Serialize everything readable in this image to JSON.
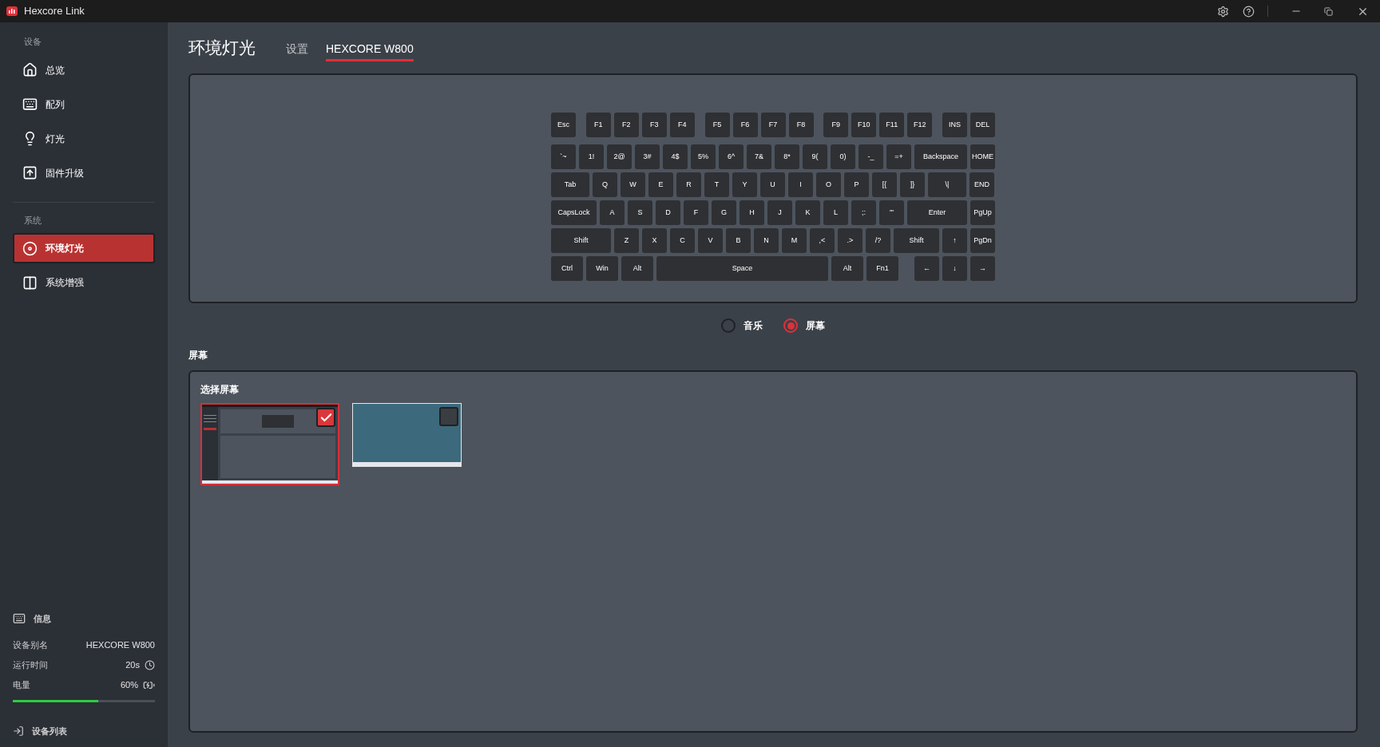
{
  "window": {
    "title": "Hexcore Link"
  },
  "sidebar": {
    "sections": [
      {
        "heading": "设备",
        "items": [
          {
            "label": "总览",
            "selected": false
          },
          {
            "label": "配列",
            "selected": false
          },
          {
            "label": "灯光",
            "selected": false
          },
          {
            "label": "固件升级",
            "selected": false
          }
        ]
      },
      {
        "heading": "系统",
        "items": [
          {
            "label": "环境灯光",
            "selected": true
          },
          {
            "label": "系统增强",
            "selected": false
          }
        ]
      }
    ],
    "info": {
      "heading": "信息",
      "rows": [
        {
          "label": "设备别名",
          "value": "HEXCORE W800",
          "kind": "text"
        },
        {
          "label": "运行时间",
          "value": "20s",
          "kind": "time"
        },
        {
          "label": "电量",
          "value": "60%",
          "kind": "battery"
        }
      ],
      "battery": {
        "level": 0.6
      }
    },
    "footer_link": "设备列表"
  },
  "page": {
    "title": "环境灯光",
    "tabs": [
      {
        "label": "设置",
        "selected": false
      },
      {
        "label": "HEXCORE W800",
        "selected": true
      }
    ]
  },
  "keyboard": {
    "rows": [
      {
        "groups": [
          [
            {
              "label": "Esc",
              "kind": "standard"
            }
          ],
          [
            {
              "label": "F1",
              "kind": "standard"
            },
            {
              "label": "F2",
              "kind": "standard"
            },
            {
              "label": "F3",
              "kind": "standard"
            },
            {
              "label": "F4",
              "kind": "standard"
            }
          ],
          [
            {
              "label": "F5",
              "kind": "standard"
            },
            {
              "label": "F6",
              "kind": "standard"
            },
            {
              "label": "F7",
              "kind": "standard"
            },
            {
              "label": "F8",
              "kind": "standard"
            }
          ],
          [
            {
              "label": "F9",
              "kind": "standard"
            },
            {
              "label": "F10",
              "kind": "standard"
            },
            {
              "label": "F11",
              "kind": "standard"
            },
            {
              "label": "F12",
              "kind": "standard"
            }
          ],
          [
            {
              "label": "INS",
              "kind": "standard"
            },
            {
              "label": "DEL",
              "kind": "standard"
            }
          ]
        ]
      },
      {
        "groups": [
          [
            {
              "label": "`~",
              "kind": "standard"
            },
            {
              "label": "1!",
              "kind": "standard"
            },
            {
              "label": "2@",
              "kind": "standard"
            },
            {
              "label": "3#",
              "kind": "standard"
            },
            {
              "label": "4$",
              "kind": "standard"
            },
            {
              "label": "5%",
              "kind": "standard"
            },
            {
              "label": "6^",
              "kind": "standard"
            },
            {
              "label": "7&",
              "kind": "standard"
            },
            {
              "label": "8*",
              "kind": "standard"
            },
            {
              "label": "9(",
              "kind": "standard"
            },
            {
              "label": "0)",
              "kind": "standard"
            },
            {
              "label": "-_",
              "kind": "standard"
            },
            {
              "label": "=+",
              "kind": "standard"
            },
            {
              "label": "Backspace",
              "kind": "backspace"
            },
            {
              "label": "HOME",
              "kind": "standard"
            }
          ]
        ]
      },
      {
        "groups": [
          [
            {
              "label": "Tab",
              "kind": "tab"
            },
            {
              "label": "Q",
              "kind": "standard"
            },
            {
              "label": "W",
              "kind": "standard"
            },
            {
              "label": "E",
              "kind": "standard"
            },
            {
              "label": "R",
              "kind": "standard"
            },
            {
              "label": "T",
              "kind": "standard"
            },
            {
              "label": "Y",
              "kind": "standard"
            },
            {
              "label": "U",
              "kind": "standard"
            },
            {
              "label": "I",
              "kind": "standard"
            },
            {
              "label": "O",
              "kind": "standard"
            },
            {
              "label": "P",
              "kind": "standard"
            },
            {
              "label": "[{",
              "kind": "standard"
            },
            {
              "label": "]}",
              "kind": "standard"
            },
            {
              "label": "\\|",
              "kind": "tab"
            },
            {
              "label": "END",
              "kind": "standard"
            }
          ]
        ]
      },
      {
        "groups": [
          [
            {
              "label": "CapsLock",
              "kind": "caps"
            },
            {
              "label": "A",
              "kind": "standard"
            },
            {
              "label": "S",
              "kind": "standard"
            },
            {
              "label": "D",
              "kind": "standard"
            },
            {
              "label": "F",
              "kind": "standard"
            },
            {
              "label": "G",
              "kind": "standard"
            },
            {
              "label": "H",
              "kind": "standard"
            },
            {
              "label": "J",
              "kind": "standard"
            },
            {
              "label": "K",
              "kind": "standard"
            },
            {
              "label": "L",
              "kind": "standard"
            },
            {
              "label": ";:",
              "kind": "standard"
            },
            {
              "label": "'\"",
              "kind": "standard"
            },
            {
              "label": "Enter",
              "kind": "enter"
            },
            {
              "label": "PgUp",
              "kind": "standard"
            }
          ]
        ]
      },
      {
        "groups": [
          [
            {
              "label": "Shift",
              "kind": "enter"
            },
            {
              "label": "Z",
              "kind": "standard"
            },
            {
              "label": "X",
              "kind": "standard"
            },
            {
              "label": "C",
              "kind": "standard"
            },
            {
              "label": "V",
              "kind": "standard"
            },
            {
              "label": "B",
              "kind": "standard"
            },
            {
              "label": "N",
              "kind": "standard"
            },
            {
              "label": "M",
              "kind": "standard"
            },
            {
              "label": ",<",
              "kind": "standard"
            },
            {
              "label": ".>",
              "kind": "standard"
            },
            {
              "label": "/?",
              "kind": "standard"
            },
            {
              "label": "Shift",
              "kind": "caps"
            },
            {
              "label": "↑",
              "kind": "standard"
            },
            {
              "label": "PgDn",
              "kind": "standard"
            }
          ]
        ]
      },
      {
        "groups": [
          [
            {
              "label": "Ctrl",
              "kind": "mod"
            },
            {
              "label": "Win",
              "kind": "mod"
            },
            {
              "label": "Alt",
              "kind": "mod"
            },
            {
              "label": "Space",
              "kind": "space"
            },
            {
              "label": "Alt",
              "kind": "mod"
            },
            {
              "label": "Fn1",
              "kind": "mod"
            }
          ],
          [
            {
              "label": "←",
              "kind": "standard"
            },
            {
              "label": "↓",
              "kind": "standard"
            },
            {
              "label": "→",
              "kind": "standard"
            }
          ]
        ]
      }
    ]
  },
  "modes": [
    {
      "label": "音乐",
      "selected": false
    },
    {
      "label": "屏幕",
      "selected": true
    }
  ],
  "screen_section": {
    "heading": "屏幕",
    "panel_title": "选择屏幕",
    "screens": [
      {
        "kind": "app_window",
        "selected": true
      },
      {
        "kind": "photo",
        "selected": false
      }
    ]
  }
}
